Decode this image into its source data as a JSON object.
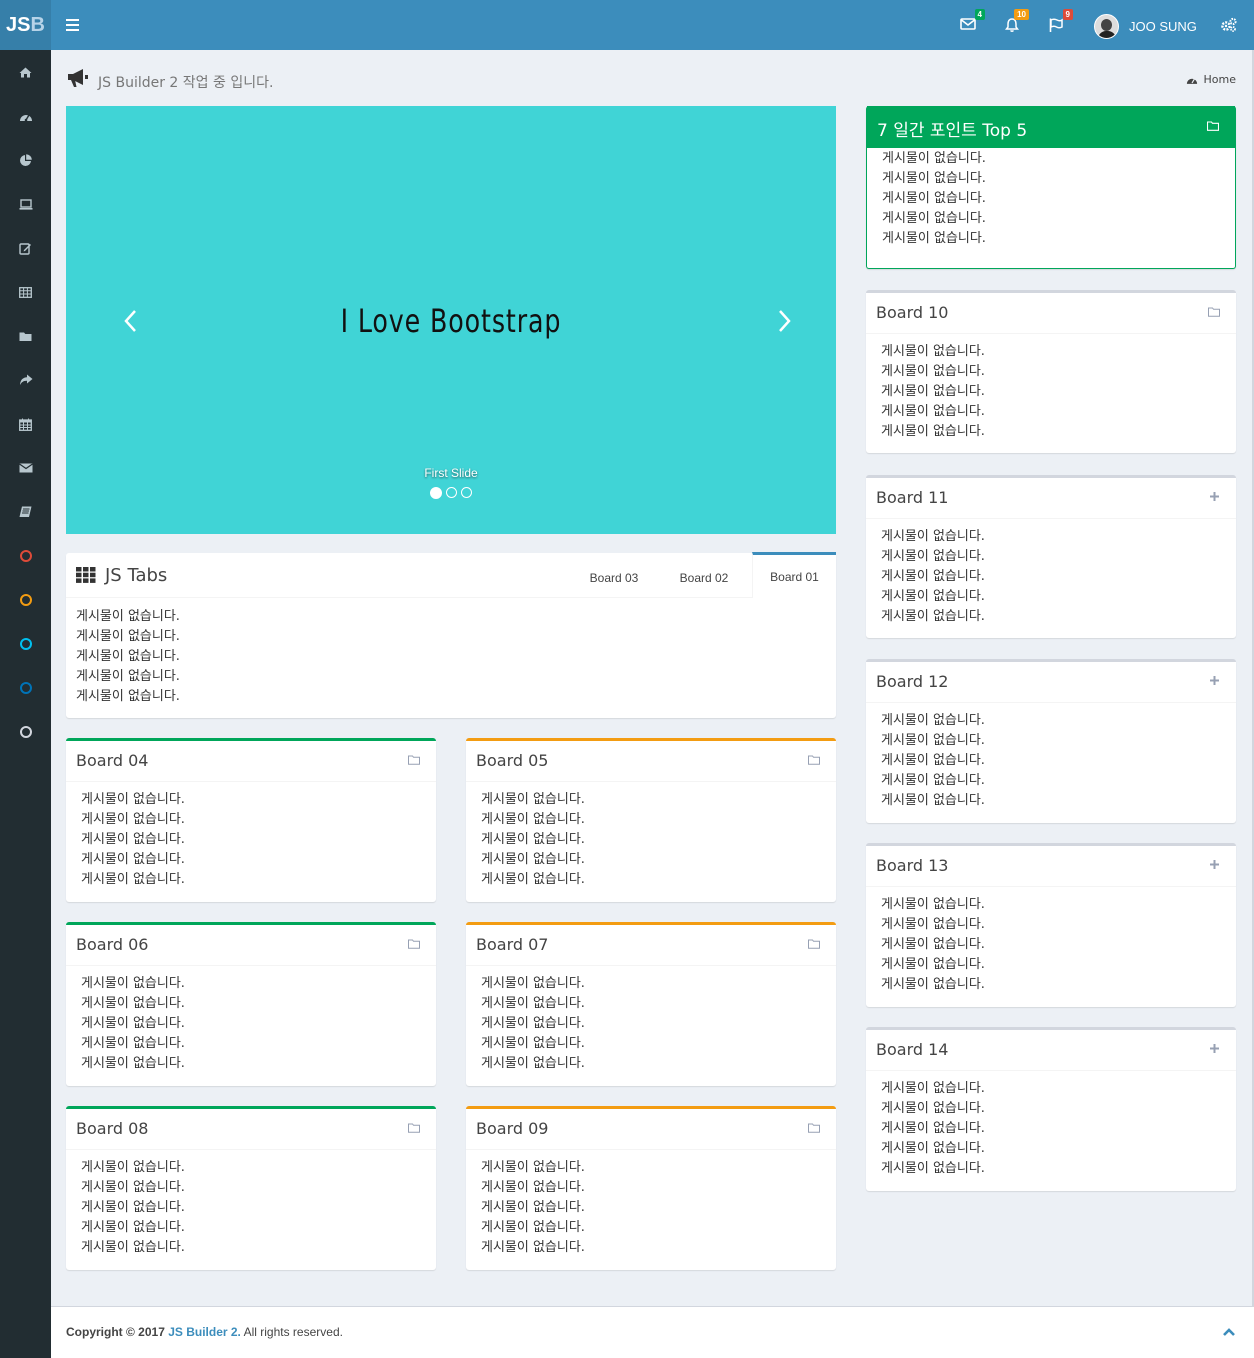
{
  "header": {
    "logo_main": "JS",
    "logo_accent": "B",
    "mail_count": "4",
    "bell_count": "10",
    "flag_count": "9",
    "user_name": "JOO SUNG",
    "colors": {
      "bar": "#3c8dbc",
      "mail_badge": "#00a65a",
      "bell_badge": "#f39c12",
      "flag_badge": "#dd4b39"
    }
  },
  "sidebar": {
    "icons": [
      "home-icon",
      "dashboard-icon",
      "pie-chart-icon",
      "laptop-icon",
      "edit-icon",
      "table-icon",
      "folder-icon",
      "share-icon",
      "calendar-icon",
      "envelope-icon",
      "book-icon"
    ],
    "circles": [
      "#dd4b39",
      "#f39c12",
      "#00c0ef",
      "#0073b7",
      "#d2d6de"
    ]
  },
  "content_header": {
    "subtitle": "JS Builder 2 작업 중 입니다.",
    "breadcrumb_home": "Home"
  },
  "carousel": {
    "slide_text": "I Love Bootstrap",
    "caption": "First Slide",
    "slides": 3,
    "active_slide": 1
  },
  "tabs": {
    "title": "JS Tabs",
    "items": [
      "Board 03",
      "Board 02",
      "Board 01"
    ],
    "active": "Board 01",
    "rows": [
      "게시물이 없습니다.",
      "게시물이 없습니다.",
      "게시물이 없습니다.",
      "게시물이 없습니다.",
      "게시물이 없습니다."
    ]
  },
  "boards": {
    "b04": {
      "title": "Board 04",
      "rows": [
        "게시물이 없습니다.",
        "게시물이 없습니다.",
        "게시물이 없습니다.",
        "게시물이 없습니다.",
        "게시물이 없습니다."
      ]
    },
    "b05": {
      "title": "Board 05",
      "rows": [
        "게시물이 없습니다.",
        "게시물이 없습니다.",
        "게시물이 없습니다.",
        "게시물이 없습니다.",
        "게시물이 없습니다."
      ]
    },
    "b06": {
      "title": "Board 06",
      "rows": [
        "게시물이 없습니다.",
        "게시물이 없습니다.",
        "게시물이 없습니다.",
        "게시물이 없습니다.",
        "게시물이 없습니다."
      ]
    },
    "b07": {
      "title": "Board 07",
      "rows": [
        "게시물이 없습니다.",
        "게시물이 없습니다.",
        "게시물이 없습니다.",
        "게시물이 없습니다.",
        "게시물이 없습니다."
      ]
    },
    "b08": {
      "title": "Board 08",
      "rows": [
        "게시물이 없습니다.",
        "게시물이 없습니다.",
        "게시물이 없습니다.",
        "게시물이 없습니다.",
        "게시물이 없습니다."
      ]
    },
    "b09": {
      "title": "Board 09",
      "rows": [
        "게시물이 없습니다.",
        "게시물이 없습니다.",
        "게시물이 없습니다.",
        "게시물이 없습니다.",
        "게시물이 없습니다."
      ]
    },
    "top5": {
      "title": "7 일간 포인트 Top 5",
      "rows": [
        "게시물이 없습니다.",
        "게시물이 없습니다.",
        "게시물이 없습니다.",
        "게시물이 없습니다.",
        "게시물이 없습니다."
      ]
    },
    "b10": {
      "title": "Board 10",
      "rows": [
        "게시물이 없습니다.",
        "게시물이 없습니다.",
        "게시물이 없습니다.",
        "게시물이 없습니다.",
        "게시물이 없습니다."
      ]
    },
    "b11": {
      "title": "Board 11",
      "rows": [
        "게시물이 없습니다.",
        "게시물이 없습니다.",
        "게시물이 없습니다.",
        "게시물이 없습니다.",
        "게시물이 없습니다."
      ]
    },
    "b12": {
      "title": "Board 12",
      "rows": [
        "게시물이 없습니다.",
        "게시물이 없습니다.",
        "게시물이 없습니다.",
        "게시물이 없습니다.",
        "게시물이 없습니다."
      ]
    },
    "b13": {
      "title": "Board 13",
      "rows": [
        "게시물이 없습니다.",
        "게시물이 없습니다.",
        "게시물이 없습니다.",
        "게시물이 없습니다.",
        "게시물이 없습니다."
      ]
    },
    "b14": {
      "title": "Board 14",
      "rows": [
        "게시물이 없습니다.",
        "게시물이 없습니다.",
        "게시물이 없습니다.",
        "게시물이 없습니다.",
        "게시물이 없습니다."
      ]
    }
  },
  "footer": {
    "prefix": "Copyright © 2017 ",
    "link": "JS Builder 2.",
    "suffix": " All rights reserved."
  }
}
